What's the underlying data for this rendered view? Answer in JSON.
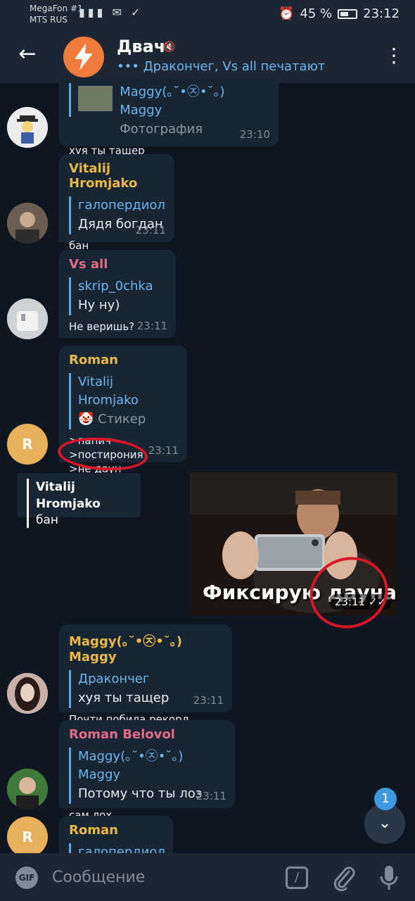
{
  "status": {
    "carrier_line1": "MegaFon #1",
    "carrier_line2": "MTS RUS",
    "battery": "45 %",
    "time": "23:12"
  },
  "header": {
    "title": "Двач",
    "typing": "Дракончег, Vs all печатают"
  },
  "messages": [
    {
      "reply_name": "Maggy(｡˘•㉨•˘｡) Maggy",
      "reply_text": "Фотография",
      "text": "хуя ты тащер",
      "time": "23:10"
    },
    {
      "sender": "Vitalij Hromjako",
      "reply_name": "галопердиол",
      "reply_text": "Дядя богдан",
      "text": "бан",
      "time": "23:11"
    },
    {
      "sender": "Vs all",
      "reply_name": "skrip_0chka",
      "reply_text": "Ну ну)",
      "text": "Не веришь?",
      "time": "23:11"
    },
    {
      "sender": "Roman",
      "avatar_letter": "R",
      "reply_name": "Vitalij Hromjako",
      "reply_text": "🤡 Стикер",
      "text_lines": [
        ">папич",
        ">постирония",
        ">не даун"
      ],
      "time": "23:11"
    },
    {
      "sender": "Maggy(｡˘•㉨•˘｡) Maggy",
      "reply_name": "Дракончег",
      "reply_text": "хуя ты тащер",
      "text": "Почти побила рекорд",
      "time": "23:11"
    },
    {
      "sender": "Roman Belovol",
      "reply_name": "Maggy(｡˘•㉨•˘｡) Maggy",
      "reply_text": "Потому что ты лоз",
      "text": "сам лох",
      "time": "23:11"
    },
    {
      "sender": "Roman",
      "avatar_letter": "R",
      "reply_name": "галопердиол"
    }
  ],
  "outgoing": {
    "reply_name": "Vitalij Hromjako",
    "reply_text": "бан",
    "photo_caption": "Фиксирую дауна",
    "time": "23:11"
  },
  "unread_count": "1",
  "composer": {
    "gif_label": "GIF",
    "placeholder": "Сообщение"
  },
  "colors": {
    "sender_yellow": "#e8b84a",
    "sender_pink": "#e26d87",
    "reply_blue": "#6fb5ee",
    "annotation_red": "#d8162a"
  }
}
